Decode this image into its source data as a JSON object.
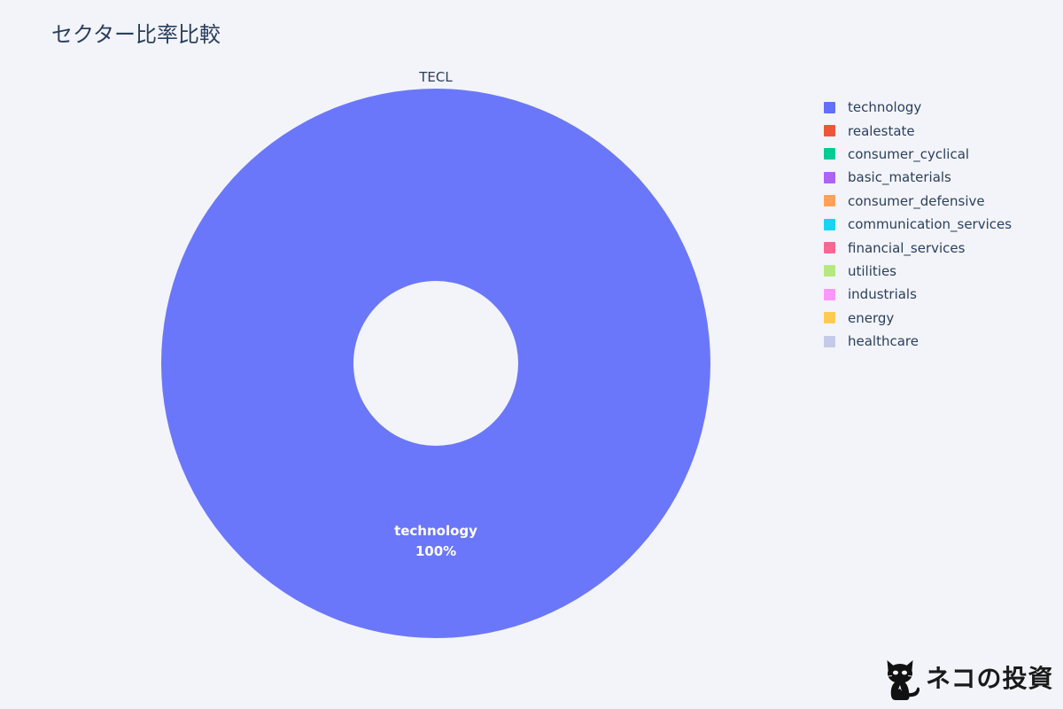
{
  "header": {
    "title": "セクター比率比較",
    "title_color": "#2a3f5f"
  },
  "background_color": "#f3f4f9",
  "chart_data": {
    "type": "pie",
    "variant": "donut",
    "title": "セクター比率比較",
    "subplot_title": "TECL",
    "hole": 0.3,
    "categories": [
      "technology"
    ],
    "values": [
      100
    ],
    "value_unit": "%",
    "slice_labels": [
      {
        "name": "technology",
        "percent": "100%"
      }
    ],
    "slice_colors": [
      "#6b77fa"
    ],
    "legend_position": "right",
    "legend": [
      {
        "label": "technology",
        "color": "#636efa"
      },
      {
        "label": "realestate",
        "color": "#ef553b"
      },
      {
        "label": "consumer_cyclical",
        "color": "#00cc96"
      },
      {
        "label": "basic_materials",
        "color": "#ab63fa"
      },
      {
        "label": "consumer_defensive",
        "color": "#ffa15a"
      },
      {
        "label": "communication_services",
        "color": "#19d3f3"
      },
      {
        "label": "financial_services",
        "color": "#ff6692"
      },
      {
        "label": "utilities",
        "color": "#b6e880"
      },
      {
        "label": "industrials",
        "color": "#ff97ff"
      },
      {
        "label": "energy",
        "color": "#fecb52"
      },
      {
        "label": "healthcare",
        "color": "#c5cae9"
      }
    ]
  },
  "watermark": {
    "icon": "cat-icon",
    "text": "ネコの投資"
  }
}
